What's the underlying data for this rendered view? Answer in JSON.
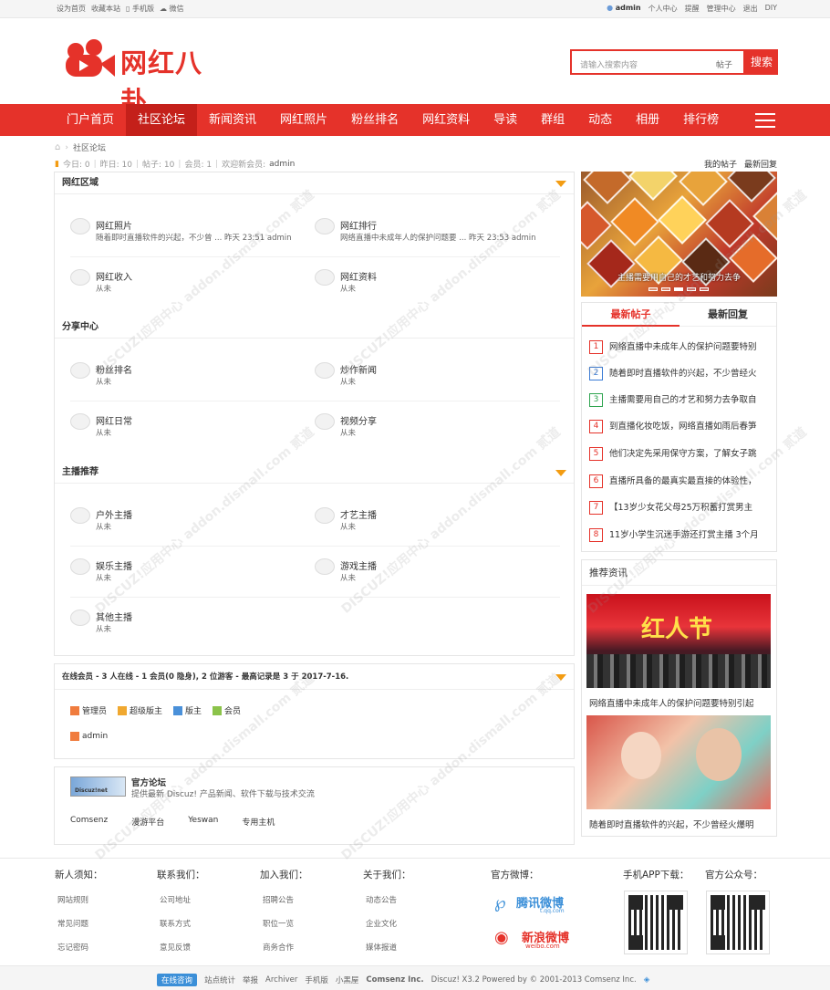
{
  "topbar": {
    "left": [
      "设为首页",
      "收藏本站",
      "手机版",
      "微信"
    ],
    "user": "admin",
    "right": [
      "个人中心",
      "提醒",
      "管理中心",
      "退出",
      "DIY"
    ]
  },
  "header": {
    "logo_text": "网红八卦",
    "search_placeholder": "请输入搜索内容",
    "search_type": "帖子",
    "search_button": "搜索"
  },
  "nav": {
    "items": [
      "门户首页",
      "社区论坛",
      "新闻资讯",
      "网红照片",
      "粉丝排名",
      "网红资料",
      "导读",
      "群组",
      "动态",
      "相册",
      "排行榜"
    ],
    "current": "社区论坛"
  },
  "breadcrumb": {
    "current": "社区论坛"
  },
  "stats": {
    "today": "今日: 0",
    "yesterday": "昨日: 10",
    "posts": "帖子: 10",
    "members": "会员: 1",
    "welcome_label": "欢迎新会员:",
    "welcome_user": "admin",
    "my_posts": "我的帖子",
    "latest_replies": "最新回复"
  },
  "sections": [
    {
      "title": "网红区域",
      "forums": [
        {
          "name": "网红照片",
          "desc": "随着即时直播软件的兴起，不少曾 ... 昨天 23:51 admin"
        },
        {
          "name": "网红排行",
          "desc": "网络直播中未成年人的保护问题要 ... 昨天 23:53 admin"
        },
        {
          "name": "网红收入",
          "desc": "从未"
        },
        {
          "name": "网红资料",
          "desc": "从未"
        }
      ]
    },
    {
      "title": "分享中心",
      "forums": [
        {
          "name": "粉丝排名",
          "desc": "从未"
        },
        {
          "name": "炒作新闻",
          "desc": "从未"
        },
        {
          "name": "网红日常",
          "desc": "从未"
        },
        {
          "name": "视频分享",
          "desc": "从未"
        }
      ]
    },
    {
      "title": "主播推荐",
      "forums": [
        {
          "name": "户外主播",
          "desc": "从未"
        },
        {
          "name": "才艺主播",
          "desc": "从未"
        },
        {
          "name": "娱乐主播",
          "desc": "从未"
        },
        {
          "name": "游戏主播",
          "desc": "从未"
        },
        {
          "name": "其他主播",
          "desc": "从未"
        }
      ]
    }
  ],
  "online": {
    "title": "在线会员 - 3 人在线 - 1 会员(0 隐身), 2 位游客 - 最高记录是 3 于 2017-7-16.",
    "legend": [
      "管理员",
      "超级版主",
      "版主",
      "会员"
    ],
    "users": [
      "admin"
    ],
    "legend_colors": [
      "#f07c3e",
      "#f0a830",
      "#4a90d9",
      "#8bc34a"
    ]
  },
  "links": {
    "site_name": "官方论坛",
    "site_desc": "提供最新 Discuz! 产品新闻、软件下载与技术交流",
    "logo_text": "Discuz!net",
    "partners": [
      "Comsenz",
      "漫游平台",
      "Yeswan",
      "专用主机"
    ]
  },
  "banner": {
    "caption": "主播需要用自己的才艺和努力去争"
  },
  "tabs": {
    "t1": "最新帖子",
    "t2": "最新回复",
    "items": [
      "网络直播中未成年人的保护问题要特别",
      "随着即时直播软件的兴起，不少曾经火",
      "主播需要用自己的才艺和努力去争取自",
      "到直播化妆吃饭，网络直播如雨后春笋",
      "他们决定先采用保守方案，了解女子跳",
      "直播所具备的最真实最直接的体验性，",
      "【13岁少女花父母25万积蓄打赏男主",
      "11岁小学生沉迷手游还打赏主播 3个月"
    ]
  },
  "recommend": {
    "title": "推荐资讯",
    "img1_text": "红人节",
    "cap1": "网络直播中未成年人的保护问题要特别引起",
    "cap2": "随着即时直播软件的兴起，不少曾经火爆明"
  },
  "footer": {
    "cols": [
      {
        "h": "新人须知：",
        "a": [
          "网站规则",
          "常见问题",
          "忘记密码"
        ]
      },
      {
        "h": "联系我们：",
        "a": [
          "公司地址",
          "联系方式",
          "意见反馈"
        ]
      },
      {
        "h": "加入我们：",
        "a": [
          "招聘公告",
          "职位一览",
          "商务合作"
        ]
      },
      {
        "h": "关于我们：",
        "a": [
          "动态公告",
          "企业文化",
          "媒体报道"
        ]
      }
    ],
    "weibo_title": "官方微博：",
    "tencent": "腾讯微博",
    "tencent_url": "t.qq.com",
    "sina": "新浪微博",
    "sina_url": "weibo.com",
    "app_title": "手机APP下载：",
    "wx_title": "官方公众号："
  },
  "bottom": [
    "在线咨询",
    "站点统计",
    "举报",
    "Archiver",
    "手机版",
    "小黑屋",
    "Comsenz Inc.",
    "Discuz! X3.2 Powered by © 2001-2013 Comsenz Inc."
  ],
  "colors": {
    "brand": "#e5322a",
    "nav_active": "#c4201a",
    "accent_triangle": "#f39c12"
  },
  "watermark": "DISCUZ!应用中心 addon.dismall.com 贰道"
}
